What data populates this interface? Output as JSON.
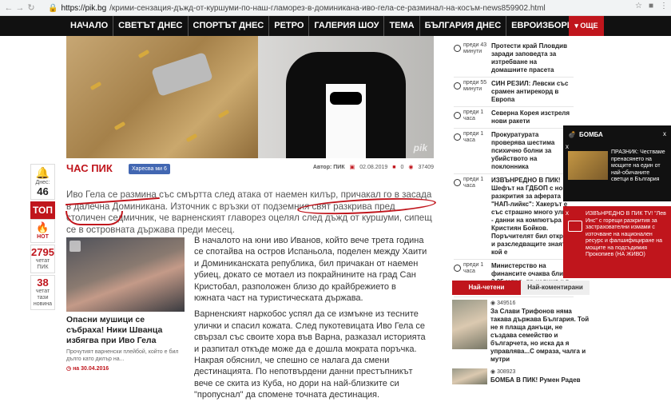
{
  "browser": {
    "url_host": "https://pik.bg",
    "url_path": "/крими-сензация-дъжд-от-куршуми-по-наш-гламорез-в-доминикана-иво-гела-се-разминал-на-косъм-news859902.html"
  },
  "nav": {
    "items": [
      "НАЧАЛО",
      "СВЕТЪТ ДНЕС",
      "СПОРТЪТ ДНЕС",
      "РЕТРО",
      "ГАЛЕРИЯ ШОУ",
      "ТЕМА",
      "БЪЛГАРИЯ ДНЕС",
      "ЕВРОИЗБОРИ"
    ],
    "more": "▾ ОЩЕ"
  },
  "hero": {
    "watermark": "pik"
  },
  "article": {
    "tag": "ЧАС ПИК",
    "fb": "Харесва ми 6",
    "author_label": "Автор:",
    "author": "ПИК",
    "date": "02.08.2019",
    "comments": "0",
    "views": "37409",
    "lead": "Иво Гела се размина със смъртта след атака от наемен килър, причакал го в засада в далечна Доминикана. Източник с връзки от подземния свят разкрива пред столичен седмичник, че варненският главорез оцелял след дъжд от куршуми, сипещ се в островната държава преди месец.",
    "paragraphs": [
      "В началото на юни иво Иванов, който вече трета година се спотайва на остров Испаньола, поделен между Хаити и Доминиканската република, бил причакан от наемен убиец, докато се мотаел из покрайнините на град Сан Кристобал, разположен близо до крайбрежието в южната част на туристическата държава.",
      "Варненският наркобос успял да се измъкне из тесните улички и спасил кожата. След пукотевицата Иво Гела се свързал със своите хора във Варна, разказал историята и разпитал откъде може да е дошла мократа поръчка. Накрая обяснил, че спешно се налага да смени дестинацията. По непотвърдени данни престъпникът вече се скита из Куба, но дори на най-близките си \"пропуснал\" да спомене точната дестинация."
    ]
  },
  "left_sidebar": {
    "today_label": "Днес:",
    "today": "46",
    "top": "ТОП",
    "hot": "HOT",
    "read_pik": "2795",
    "read_pik_label": "четат ПИК",
    "read_news": "38",
    "read_news_label": "четат тази новина"
  },
  "related": {
    "title": "Опасни мушици се събраха! Ники Шванца избягва при Иво Гела",
    "sub": "Прочутият варненски плейбой, който е бил дълго като дилър на...",
    "date": "на 30.04.2016"
  },
  "news": [
    {
      "time": "преди 43 минути",
      "title": "Протести край Пловдив заради заповедта за изтребване на домашните прасета"
    },
    {
      "time": "преди 55 минути",
      "title": "СИН РЕЗИЛ: Левски със срамен антирекорд в Европа"
    },
    {
      "time": "преди 1 часа",
      "title": "Северна Корея изстреля нови ракети"
    },
    {
      "time": "преди 1 часа",
      "title": "Прокуратурата проверява шестима психично болни за убийството на поклонника"
    },
    {
      "time": "преди 1 часа",
      "title": "ИЗВЪНРЕДНО В ПИК! Шефът на ГДБОП с нови разкрития за аферата \"НАП-лийкс\": Хакерът е със страшно много улики - данни на компютъра на Кристиян Бойков. Поръчителят бил открит и разследващите знаят кой е"
    },
    {
      "time": "преди 1 часа",
      "title": "Министерство на финансите очаква близо 3,25 млрд. лв излишък в края на юли"
    }
  ],
  "popup1": {
    "brand": "БОМБА",
    "text": "ПРАЗНИК: Честваме пренасянето на мощите на един от най-обичаните светци в България"
  },
  "popup2": {
    "text": "ИЗВЪНРЕДНО В ПИК TV! \"Лев Инс\" с горещи разкрития за застрахователни измами с източване на национален ресурс и фалшифициране на мощите на подсъдимия Прокопиев (НА ЖИВО)"
  },
  "tabs": [
    "Най-четени",
    "Най-коментирани"
  ],
  "popular": [
    {
      "views": "349516",
      "title": "За Слави Трифонов няма такава държава България. Той не я плаща данъци, не създава семейство и българчета, но иска да я управлява...С омраза, чалга и мутри"
    },
    {
      "views": "308923",
      "title": "БОМБА В ПИК! Румен Радев"
    }
  ]
}
